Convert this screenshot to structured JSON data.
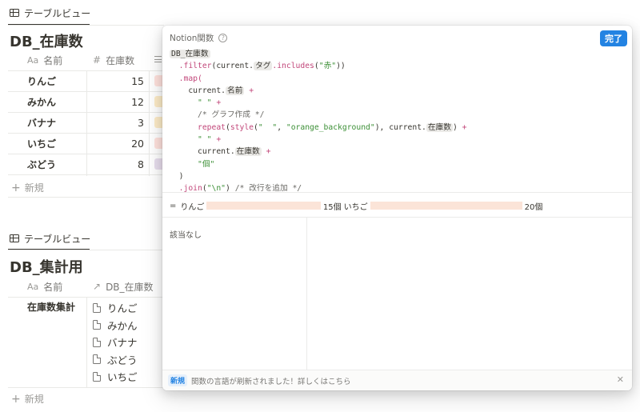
{
  "db1": {
    "tab_label": "テーブルビュー",
    "title": "DB_在庫数",
    "col_name": "名前",
    "col_count": "在庫数",
    "col_name_icon": "Aa",
    "col_count_icon": "#",
    "rows": [
      {
        "name": "りんご",
        "count": "15",
        "tag_color": "#ffe2dd"
      },
      {
        "name": "みかん",
        "count": "12",
        "tag_color": "#fdecc8"
      },
      {
        "name": "バナナ",
        "count": "3",
        "tag_color": "#fdecc8"
      },
      {
        "name": "いちご",
        "count": "20",
        "tag_color": "#ffe2dd"
      },
      {
        "name": "ぶどう",
        "count": "8",
        "tag_color": "#e8deee"
      }
    ],
    "new_label": "新規"
  },
  "db2": {
    "tab_label": "テーブルビュー",
    "title": "DB_集計用",
    "col_name": "名前",
    "col_name_icon": "Aa",
    "col_rel": "DB_在庫数",
    "row_name": "在庫数集計",
    "relations": [
      "りんご",
      "みかん",
      "バナナ",
      "ぶどう",
      "いちご"
    ],
    "new_label": "新規"
  },
  "popup": {
    "title": "Notion関数",
    "done_label": "完了",
    "result_prefix": "=",
    "results": [
      {
        "name": "りんご",
        "bar_ratio": 15,
        "suffix": "15個"
      },
      {
        "name": "いちご",
        "bar_ratio": 20,
        "suffix": "20個"
      }
    ],
    "no_match": "該当なし",
    "notice_badge": "新規",
    "notice_text": "関数の言語が刷新されました！詳しくはこちら",
    "code": {
      "db": "DB_在庫数",
      "filter": ".filter",
      "current": "current.",
      "tag_prop": "タグ",
      "includes": ".includes",
      "aka": "\"赤\"",
      "map": ".map(",
      "name_prop": "名前",
      "space_str": "\" \"",
      "comment_graph": "/* グラフ作成 */",
      "repeat": "repeat",
      "style": "style",
      "space2": "\"  \"",
      "orange": "\"orange_background\"",
      "count_prop": "在庫数",
      "ko": "\"個\"",
      "join": ".join",
      "newline": "\"\\n\"",
      "comment_nl": "/* 改行を追加 */"
    }
  },
  "colors": {
    "accent": "#2383e2",
    "bar": "#fbe4d8",
    "keyword": "#c2477a",
    "string": "#3b8f35"
  }
}
